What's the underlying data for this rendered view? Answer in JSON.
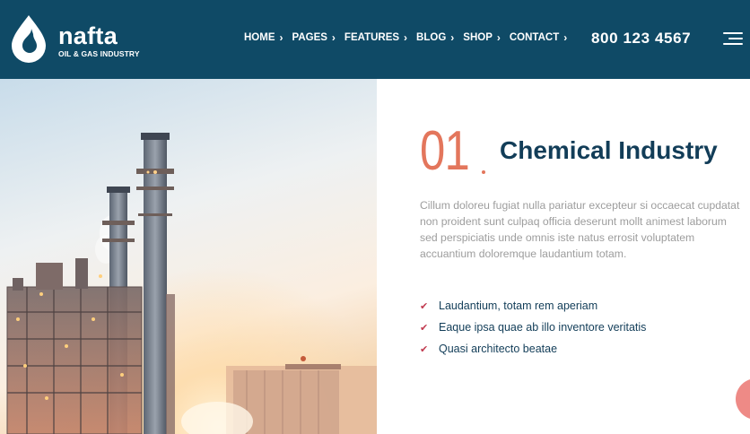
{
  "brand": {
    "name": "nafta",
    "tagline": "OIL & GAS INDUSTRY"
  },
  "nav": {
    "items": [
      {
        "label": "HOME"
      },
      {
        "label": "PAGES"
      },
      {
        "label": "FEATURES"
      },
      {
        "label": "BLOG"
      },
      {
        "label": "SHOP"
      },
      {
        "label": "CONTACT"
      }
    ],
    "chevron": "›"
  },
  "phone": "800 123 4567",
  "section": {
    "number": "01",
    "title": "Chemical Industry",
    "description": "Cillum doloreu fugiat nulla pariatur excepteur si occaecat cupdatat\nnon proident sunt culpaq officia deserunt mollt animest laborum\nsed perspiciatis unde omnis iste natus errosit voluptatem\naccuantium doloremque laudantium totam.",
    "features": [
      "Laudantium, totam rem aperiam",
      "Eaque ipsa quae ab illo inventore veritatis",
      "Quasi architecto beatae"
    ],
    "check_glyph": "✔"
  },
  "colors": {
    "header_bg": "#0f4a66",
    "accent": "#e3765c",
    "title": "#123d58",
    "check": "#c13a4f"
  },
  "icons": {
    "logo": "oil-drop-logo-icon",
    "menu": "hamburger-menu-icon",
    "check": "check-icon"
  }
}
